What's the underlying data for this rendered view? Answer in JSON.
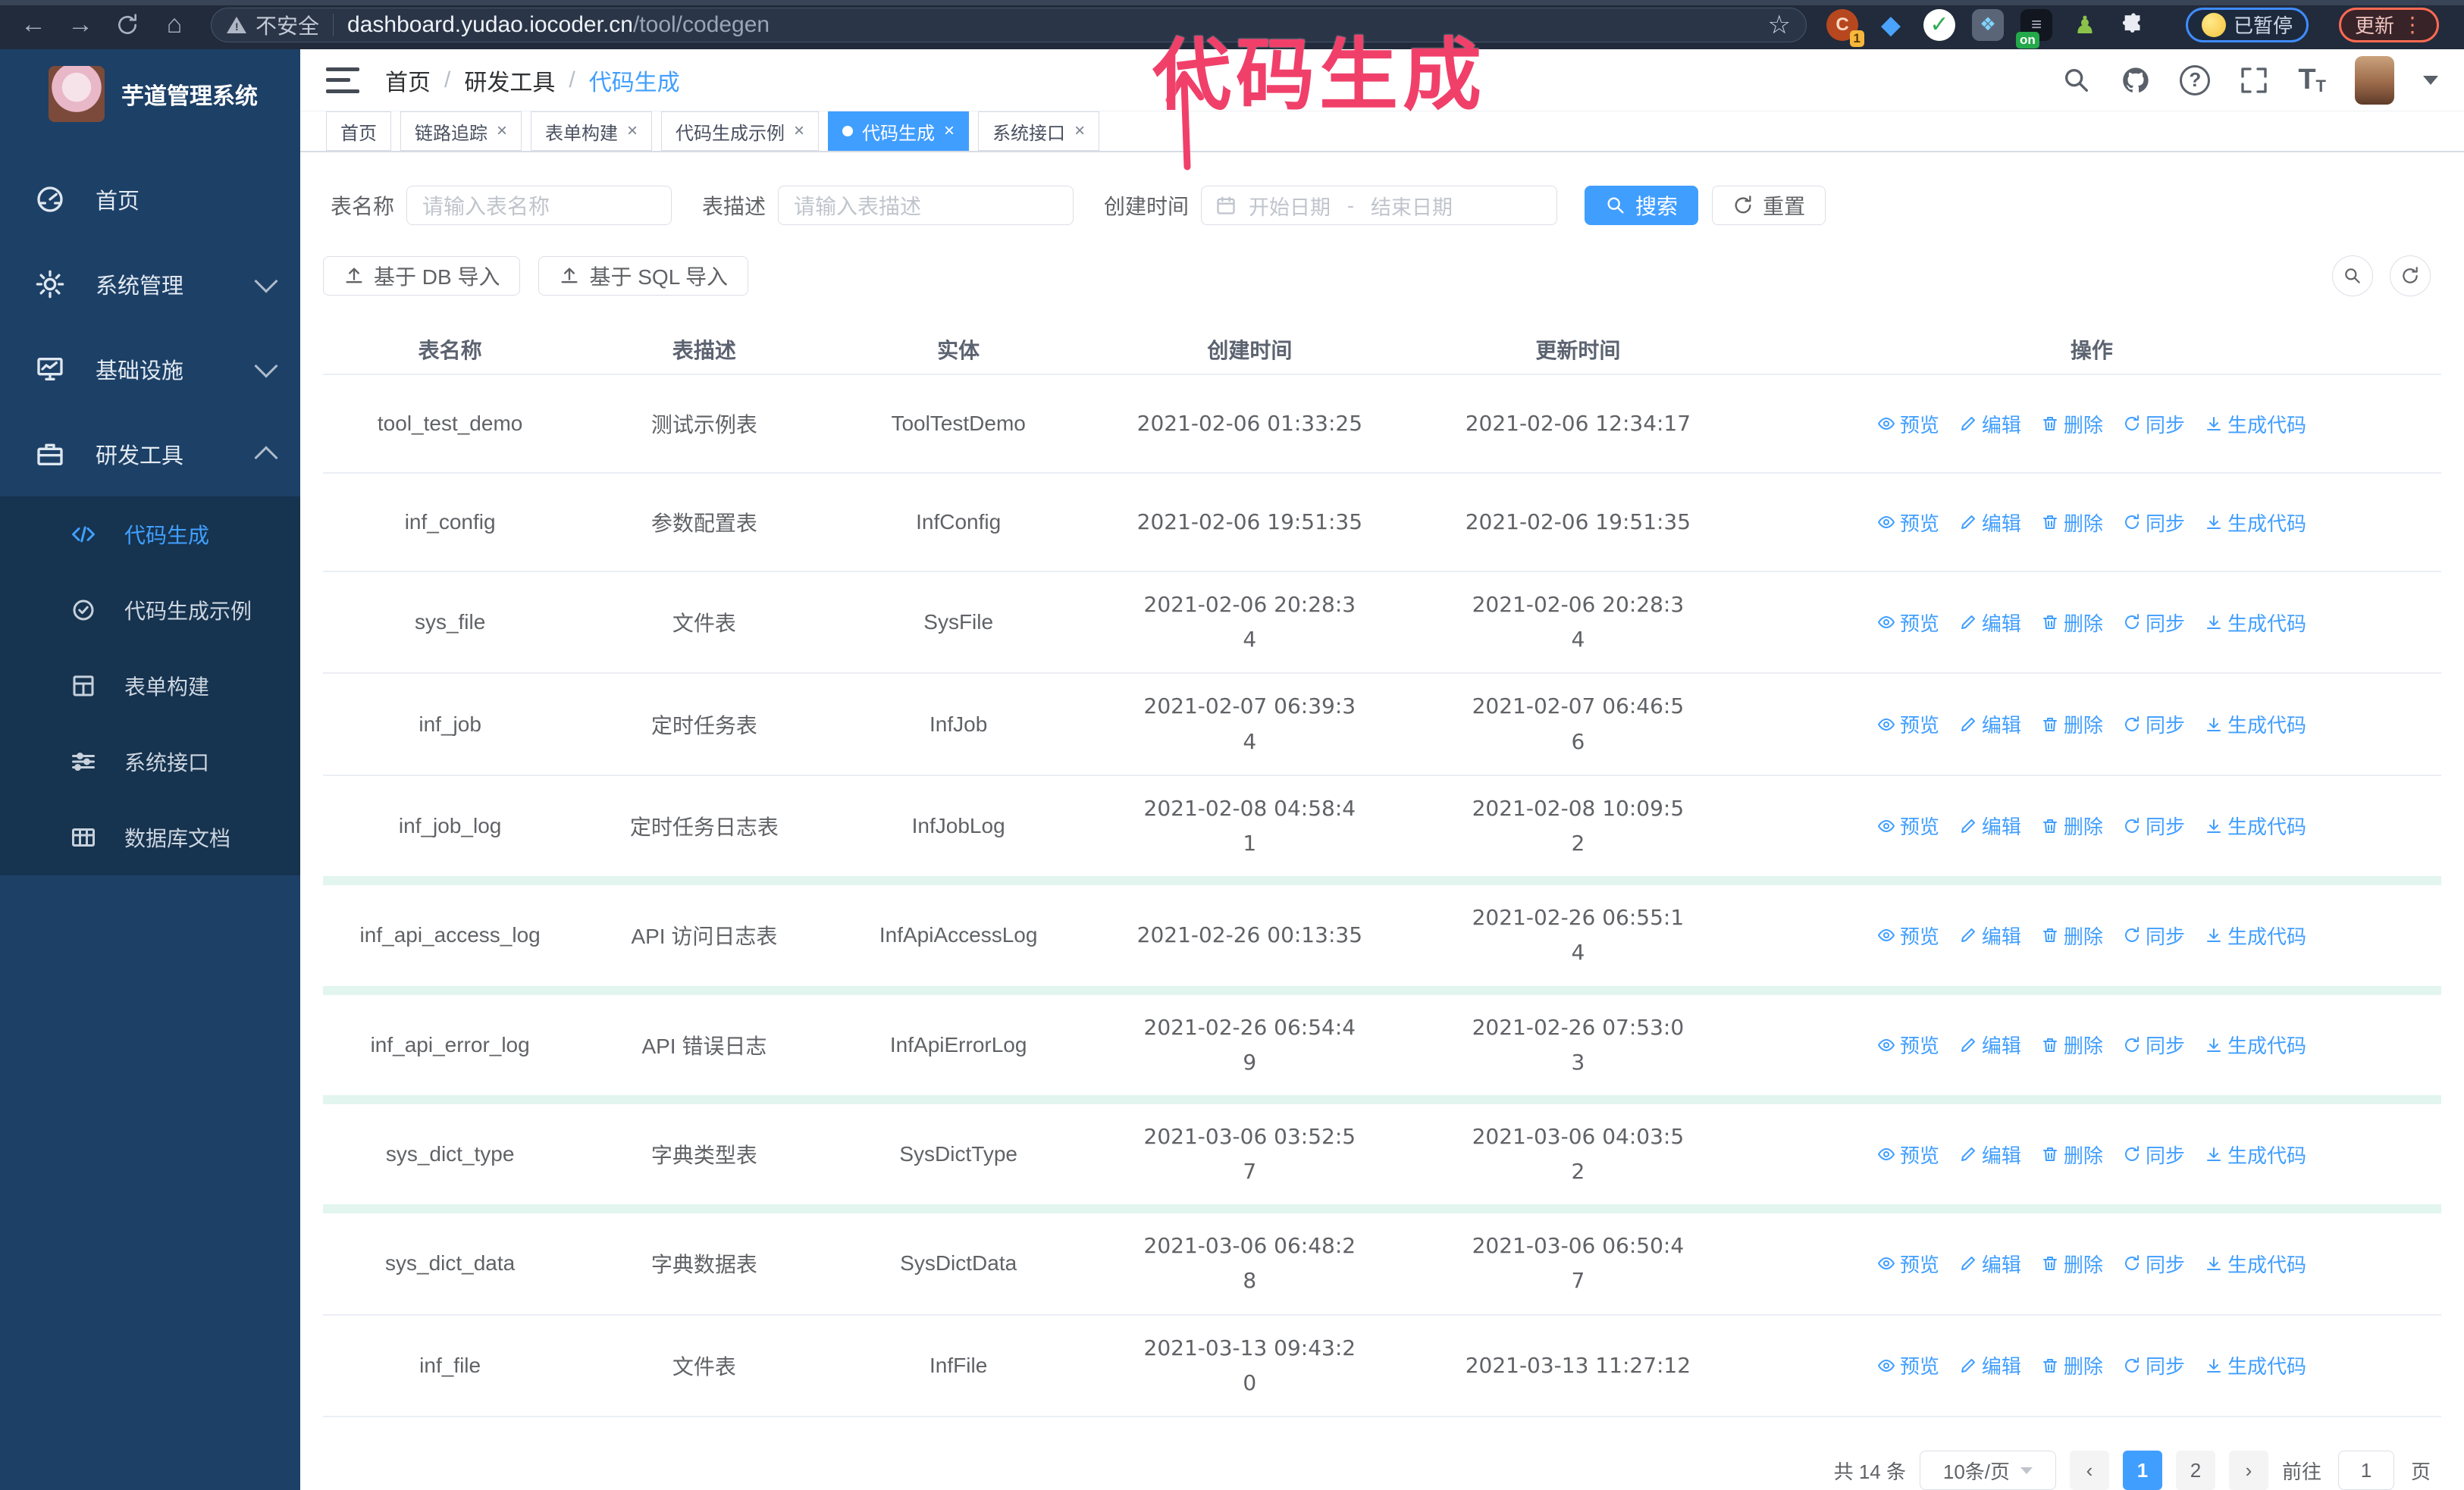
{
  "browser": {
    "security_chip": "不安全",
    "url_host": "dashboard.yudao.iocoder.cn",
    "url_path": "/tool/codegen",
    "paused_badge": "已暂停",
    "update_badge": "更新",
    "extension_count_badge": "1",
    "extension_on_badge": "on"
  },
  "annotation": {
    "title": "代码生成"
  },
  "icons": {
    "back": "←",
    "forward": "→",
    "home": "⌂",
    "star": "☆",
    "warning": "!",
    "question": "?",
    "kebab": "⋮",
    "check": "✓",
    "gem": "◆",
    "text_large": "T",
    "text_small": "T",
    "prev": "‹",
    "next": "›",
    "close": "×"
  },
  "sidebar": {
    "logo_title": "芋道管理系统",
    "items": [
      {
        "label": "首页"
      },
      {
        "label": "系统管理"
      },
      {
        "label": "基础设施"
      },
      {
        "label": "研发工具"
      }
    ],
    "subitems": [
      {
        "label": "代码生成",
        "active": true
      },
      {
        "label": "代码生成示例",
        "active": false
      },
      {
        "label": "表单构建",
        "active": false
      },
      {
        "label": "系统接口",
        "active": false
      },
      {
        "label": "数据库文档",
        "active": false
      }
    ]
  },
  "header": {
    "breadcrumb": [
      "首页",
      "研发工具",
      "代码生成"
    ]
  },
  "tabs": [
    {
      "label": "首页",
      "closable": false,
      "active": false
    },
    {
      "label": "链路追踪",
      "closable": true,
      "active": false
    },
    {
      "label": "表单构建",
      "closable": true,
      "active": false
    },
    {
      "label": "代码生成示例",
      "closable": true,
      "active": false
    },
    {
      "label": "代码生成",
      "closable": true,
      "active": true
    },
    {
      "label": "系统接口",
      "closable": true,
      "active": false
    }
  ],
  "filters": {
    "table_name_label": "表名称",
    "table_name_placeholder": "请输入表名称",
    "table_desc_label": "表描述",
    "table_desc_placeholder": "请输入表描述",
    "create_time_label": "创建时间",
    "date_start_placeholder": "开始日期",
    "date_separator": "-",
    "date_end_placeholder": "结束日期",
    "search_label": "搜索",
    "reset_label": "重置"
  },
  "toolbar": {
    "import_db": "基于 DB 导入",
    "import_sql": "基于 SQL 导入"
  },
  "table": {
    "columns": [
      "表名称",
      "表描述",
      "实体",
      "创建时间",
      "更新时间",
      "操作"
    ],
    "actions": [
      "预览",
      "编辑",
      "删除",
      "同步",
      "生成代码"
    ],
    "rows": [
      {
        "name": "tool_test_demo",
        "desc": "测试示例表",
        "entity": "ToolTestDemo",
        "created": "2021-02-06 01:33:25",
        "updated": "2021-02-06 12:34:17",
        "wrap_created": false,
        "wrap_updated": false,
        "mint": false
      },
      {
        "name": "inf_config",
        "desc": "参数配置表",
        "entity": "InfConfig",
        "created": "2021-02-06 19:51:35",
        "updated": "2021-02-06 19:51:35",
        "wrap_created": false,
        "wrap_updated": false,
        "mint": false
      },
      {
        "name": "sys_file",
        "desc": "文件表",
        "entity": "SysFile",
        "created": "2021-02-06 20:28:34",
        "updated": "2021-02-06 20:28:34",
        "wrap_created": true,
        "wrap_updated": true,
        "mint": false
      },
      {
        "name": "inf_job",
        "desc": "定时任务表",
        "entity": "InfJob",
        "created": "2021-02-07 06:39:34",
        "updated": "2021-02-07 06:46:56",
        "wrap_created": true,
        "wrap_updated": true,
        "mint": false
      },
      {
        "name": "inf_job_log",
        "desc": "定时任务日志表",
        "entity": "InfJobLog",
        "created": "2021-02-08 04:58:41",
        "updated": "2021-02-08 10:09:52",
        "wrap_created": true,
        "wrap_updated": true,
        "mint": false
      },
      {
        "name": "inf_api_access_log",
        "desc": "API 访问日志表",
        "entity": "InfApiAccessLog",
        "created": "2021-02-26 00:13:35",
        "updated": "2021-02-26 06:55:14",
        "wrap_created": false,
        "wrap_updated": true,
        "mint": true
      },
      {
        "name": "inf_api_error_log",
        "desc": "API 错误日志",
        "entity": "InfApiErrorLog",
        "created": "2021-02-26 06:54:49",
        "updated": "2021-02-26 07:53:03",
        "wrap_created": true,
        "wrap_updated": true,
        "mint": true
      },
      {
        "name": "sys_dict_type",
        "desc": "字典类型表",
        "entity": "SysDictType",
        "created": "2021-03-06 03:52:57",
        "updated": "2021-03-06 04:03:52",
        "wrap_created": true,
        "wrap_updated": true,
        "mint": true
      },
      {
        "name": "sys_dict_data",
        "desc": "字典数据表",
        "entity": "SysDictData",
        "created": "2021-03-06 06:48:28",
        "updated": "2021-03-06 06:50:47",
        "wrap_created": true,
        "wrap_updated": true,
        "mint": true
      },
      {
        "name": "inf_file",
        "desc": "文件表",
        "entity": "InfFile",
        "created": "2021-03-13 09:43:20",
        "updated": "2021-03-13 11:27:12",
        "wrap_created": true,
        "wrap_updated": false,
        "mint": false
      }
    ]
  },
  "pagination": {
    "total_text": "共 14 条",
    "page_size": "10条/页",
    "pages": [
      "1",
      "2"
    ],
    "active_page": "1",
    "goto_label": "前往",
    "goto_value": "1",
    "goto_suffix": "页"
  }
}
